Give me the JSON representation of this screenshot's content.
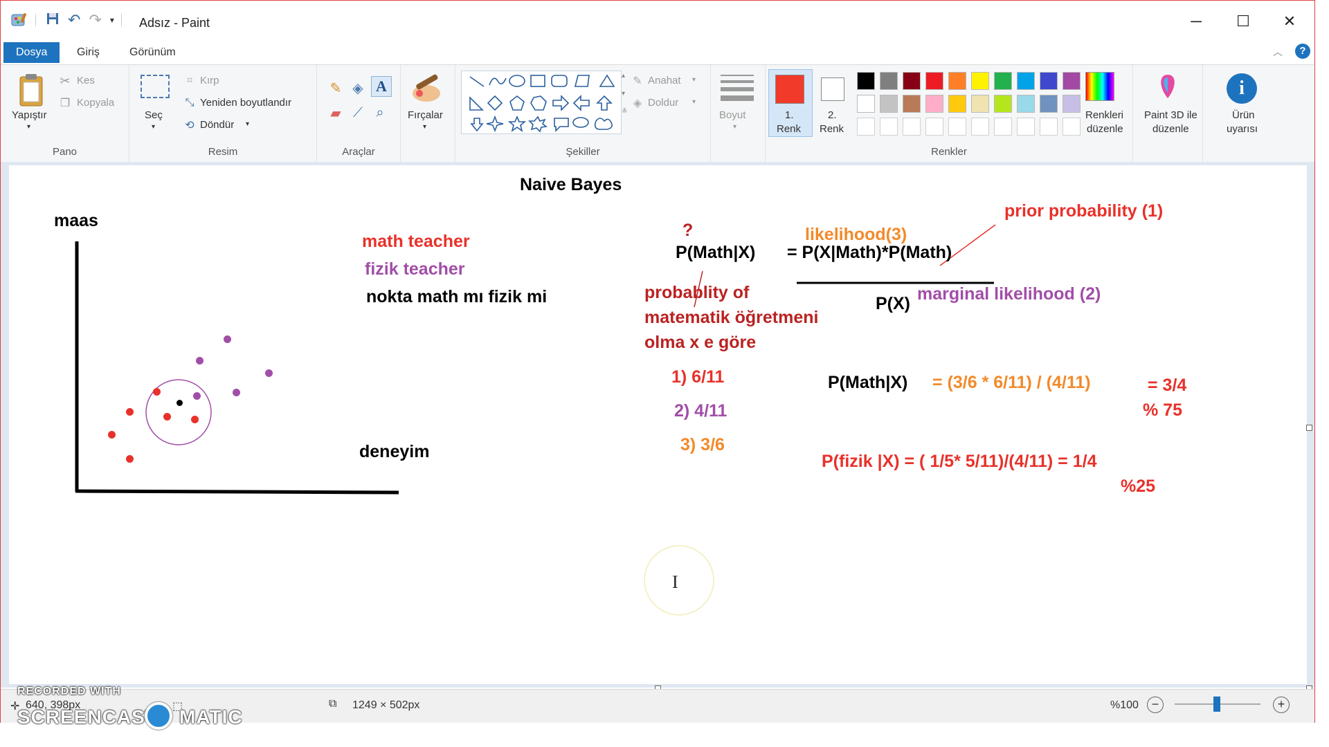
{
  "window": {
    "title": "Adsız - Paint"
  },
  "tabs": [
    "Dosya",
    "Giriş",
    "Görünüm"
  ],
  "ribbon": {
    "pano": {
      "label": "Pano",
      "paste": "Yapıştır",
      "cut": "Kes",
      "copy": "Kopyala"
    },
    "resim": {
      "label": "Resim",
      "select": "Seç",
      "crop": "Kırp",
      "resize": "Yeniden boyutlandır",
      "rotate": "Döndür"
    },
    "araclar": {
      "label": "Araçlar"
    },
    "brushes": "Fırçalar",
    "sekiller": {
      "label": "Şekiller",
      "outline": "Anahat",
      "fill": "Doldur"
    },
    "size": "Boyut",
    "colors": {
      "label": "Renkler",
      "color1_num": "1.",
      "color1_word": "Renk",
      "color2_num": "2.",
      "color2_word": "Renk",
      "edit_colors_line1": "Renkleri",
      "edit_colors_line2": "düzenle",
      "color1": "#f23a2a",
      "color2": "#ffffff",
      "palette_row1": [
        "#000000",
        "#7f7f7f",
        "#880015",
        "#ed1c24",
        "#ff7f27",
        "#fff200",
        "#22b14c",
        "#00a2e8",
        "#3f48cc",
        "#a349a4"
      ],
      "palette_row2": [
        "#ffffff",
        "#c3c3c3",
        "#b97a57",
        "#ffaec9",
        "#ffc90e",
        "#efe4b0",
        "#b5e61d",
        "#99d9ea",
        "#7092be",
        "#c8bfe7"
      ]
    },
    "paint3d_line1": "Paint 3D ile",
    "paint3d_line2": "düzenle",
    "product_alert_line1": "Ürün",
    "product_alert_line2": "uyarısı"
  },
  "canvas_text": {
    "title": "Naive Bayes",
    "y_axis": "maas",
    "x_axis": "deneyim",
    "legend_math": "math teacher",
    "legend_fizik": "fizik teacher",
    "question": "nokta math mı fizik mi",
    "qmark": "?",
    "pmathx": "P(Math|X)",
    "numerator": "= P(X|Math)*P(Math)",
    "denominator": "P(X)",
    "likelihood": "likelihood(3)",
    "prior": "prior probability   (1)",
    "marginal": "marginal likelihood (2)",
    "prob_line1": "probablity of",
    "prob_line2": "matematik öğretmeni",
    "prob_line3": "olma x e göre",
    "v1": "1) 6/11",
    "v2": "2) 4/11",
    "v3": "3) 3/6",
    "calc_label": "P(Math|X)",
    "calc_expr": "= (3/6 * 6/11) / (4/11)",
    "calc_result": "= 3/4",
    "calc_percent": "% 75",
    "fizik_calc": "P(fizik |X) =  ( 1/5* 5/11)/(4/11) = 1/4",
    "fizik_percent": "%25"
  },
  "status": {
    "cursor_pos": "640, 398px",
    "canvas_size": "1249 × 502px",
    "zoom": "%100"
  },
  "watermark": {
    "line1": "RECORDED WITH",
    "line2": "SCREENCAST",
    "line3": "MATIC"
  },
  "colors": {
    "red": "#e8312a",
    "purple": "#a14ea8",
    "orange": "#f28a2a",
    "accent": "#1e73be"
  }
}
